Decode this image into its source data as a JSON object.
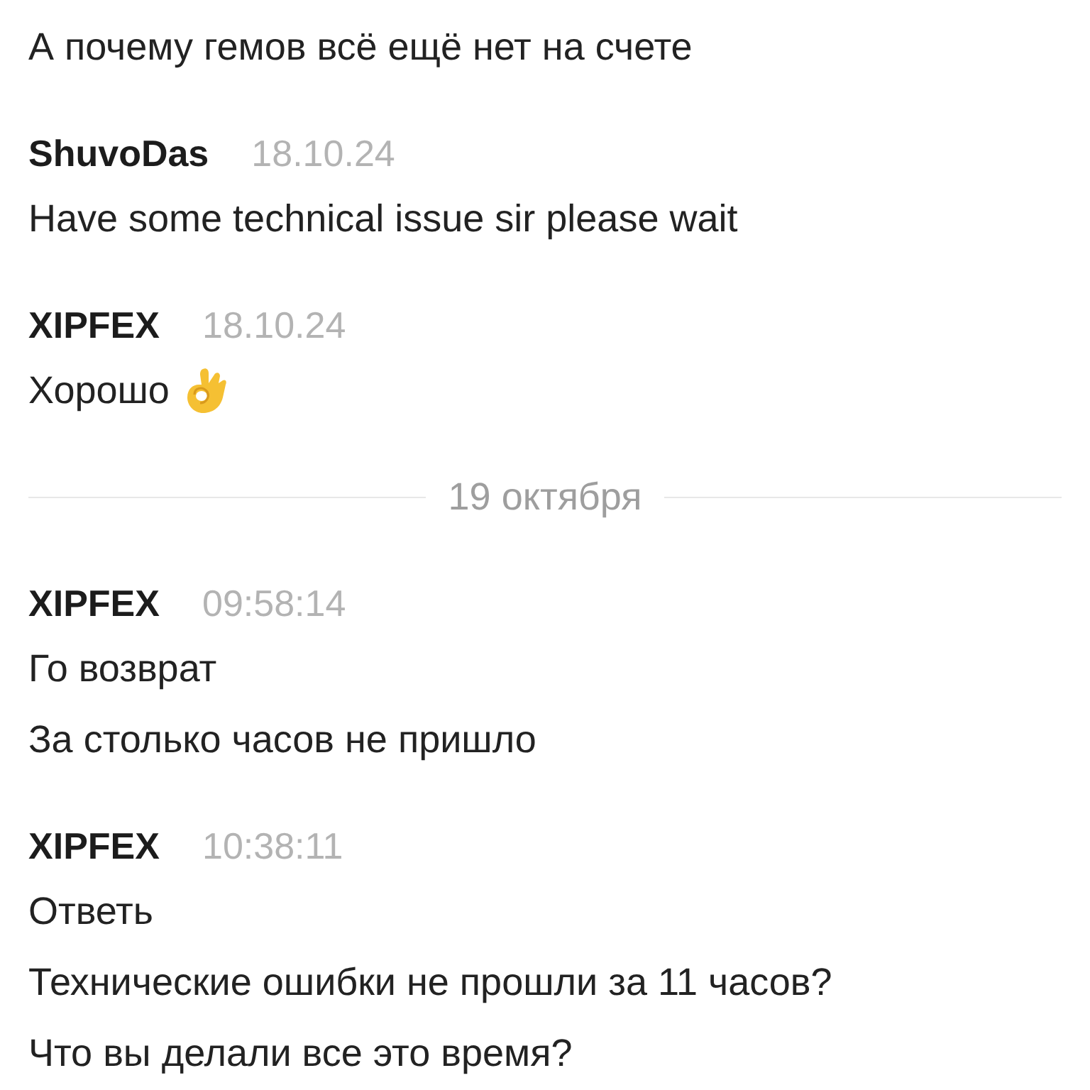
{
  "chat": {
    "feed": [
      {
        "kind": "messages",
        "messages": [
          {
            "text": "А почему гемов всё ещё нет на счете",
            "emoji": false
          }
        ]
      },
      {
        "kind": "messages",
        "author": "ShuvoDas",
        "time": "18.10.24",
        "messages": [
          {
            "text": "Have some technical issue sir please wait",
            "emoji": false
          }
        ]
      },
      {
        "kind": "messages",
        "author": "XIPFEX",
        "time": "18.10.24",
        "messages": [
          {
            "text": "Хорошо",
            "emoji": true
          }
        ]
      },
      {
        "kind": "date_divider",
        "label": "19 октября"
      },
      {
        "kind": "messages",
        "author": "XIPFEX",
        "time": "09:58:14",
        "messages": [
          {
            "text": "Го возврат",
            "emoji": false
          },
          {
            "text": "За столько часов не пришло",
            "emoji": false
          }
        ]
      },
      {
        "kind": "messages",
        "author": "XIPFEX",
        "time": "10:38:11",
        "messages": [
          {
            "text": "Ответь",
            "emoji": false
          },
          {
            "text": "Технические ошибки не прошли за 11 часов?",
            "emoji": false
          },
          {
            "text": "Что вы делали все это время?",
            "emoji": false
          }
        ]
      }
    ]
  }
}
